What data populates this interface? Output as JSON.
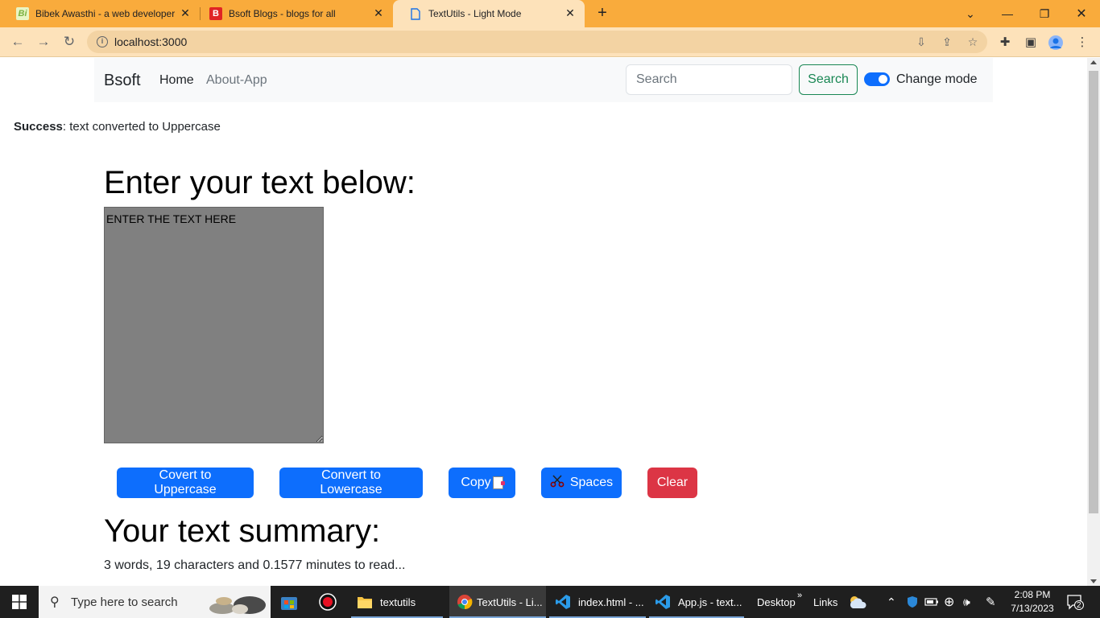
{
  "browser": {
    "tabs": [
      {
        "title": "Bibek Awasthi - a web developer",
        "favicon": "Bi"
      },
      {
        "title": "Bsoft Blogs - blogs for all",
        "favicon": "B"
      },
      {
        "title": "TextUtils - Light Mode",
        "favicon": "doc"
      }
    ],
    "url": "localhost:3000",
    "accent": "#f9ab3c"
  },
  "navbar": {
    "brand": "Bsoft",
    "links": [
      "Home",
      "About-App"
    ],
    "search_placeholder": "Search",
    "search_button": "Search",
    "mode_label": "Change mode"
  },
  "alert": {
    "type": "Success",
    "message": ": text converted to Uppercase"
  },
  "main": {
    "heading": "Enter your text below:",
    "textarea_value": "ENTER THE TEXT HERE",
    "buttons": {
      "uppercase": "Covert to Uppercase",
      "lowercase": "Convert to Lowercase",
      "copy": "Copy",
      "spaces": "Spaces",
      "clear": "Clear"
    },
    "summary_heading": "Your text summary:",
    "summary_text": "3 words, 19 characters and 0.1577 minutes to read..."
  },
  "taskbar": {
    "search_placeholder": "Type here to search",
    "apps": [
      {
        "label": "textutils",
        "icon": "folder-icon"
      },
      {
        "label": "TextUtils - Li...",
        "icon": "chrome-icon"
      },
      {
        "label": "index.html - ...",
        "icon": "vscode-icon"
      },
      {
        "label": "App.js - text...",
        "icon": "vscode-icon"
      }
    ],
    "desktop": "Desktop",
    "links": "Links",
    "time": "2:08 PM",
    "date": "7/13/2023",
    "notifications": "2"
  }
}
